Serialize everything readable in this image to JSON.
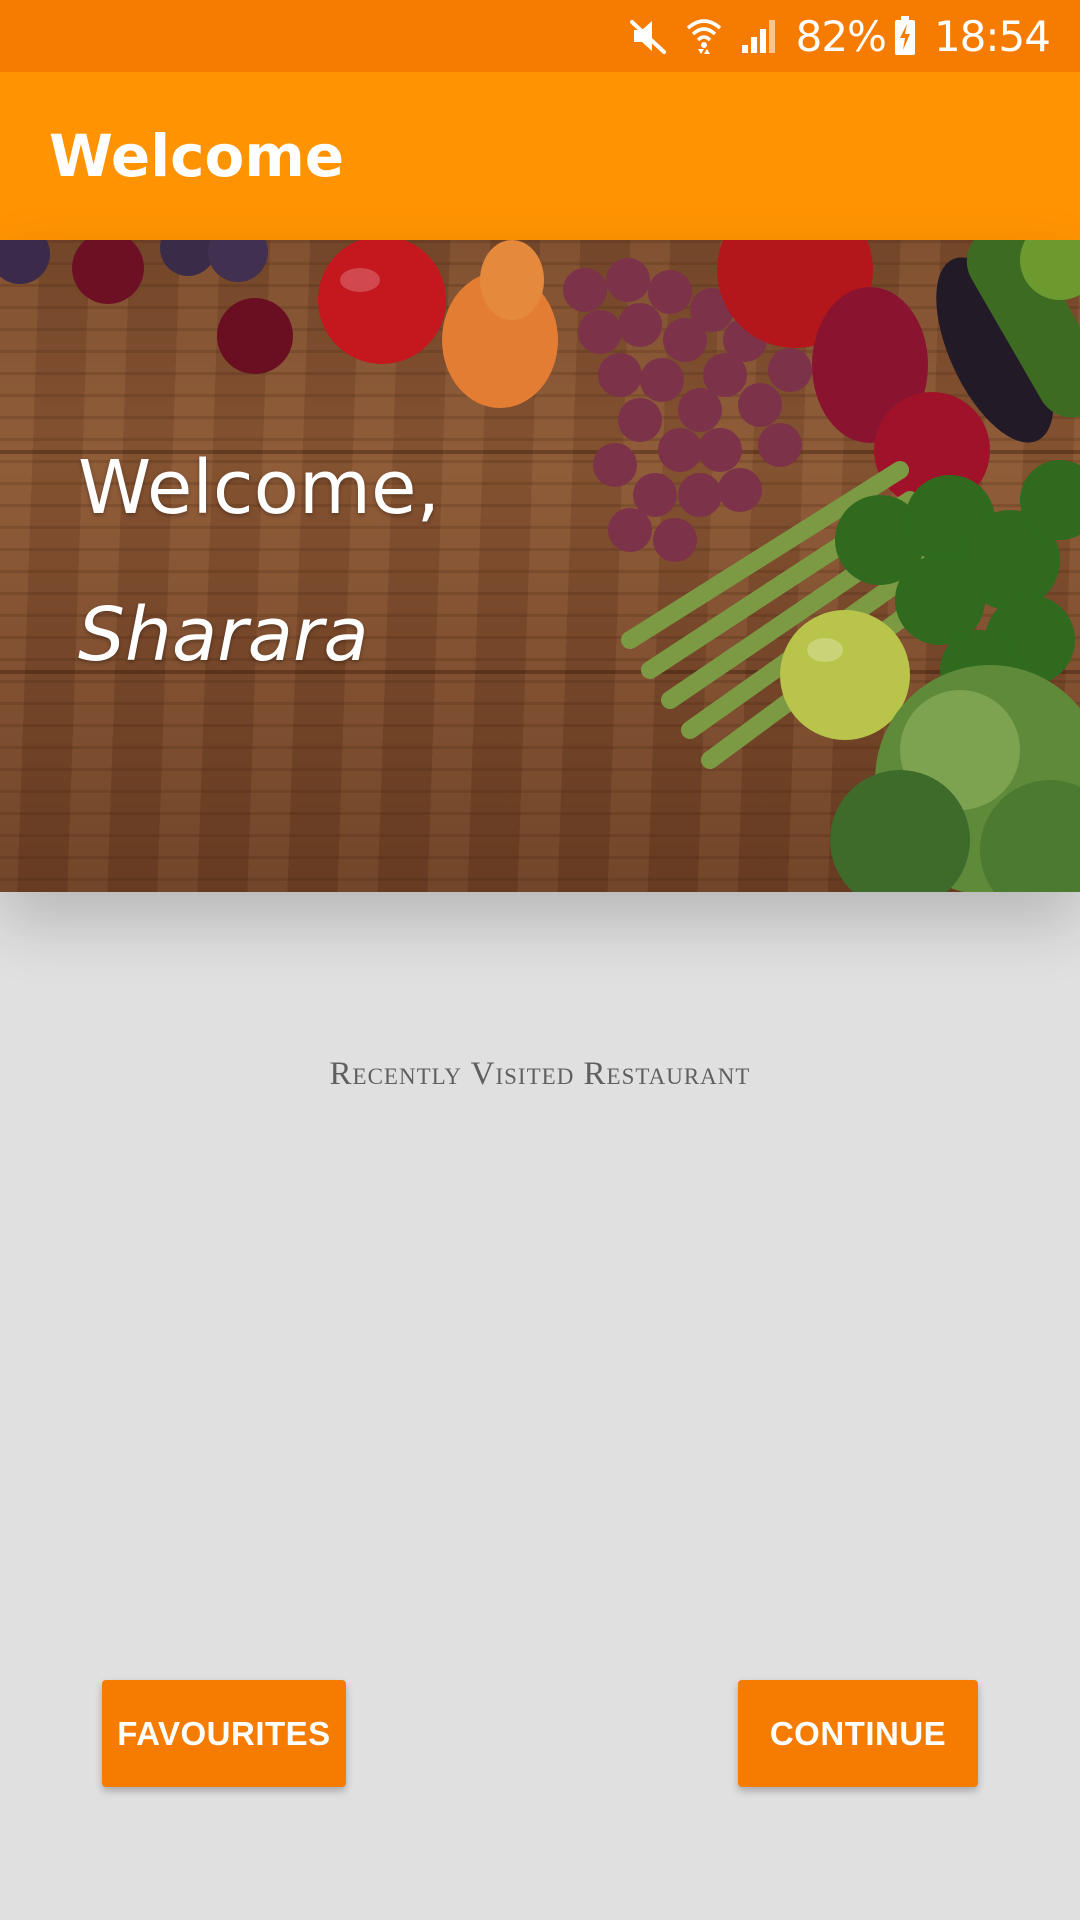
{
  "status_bar": {
    "battery": "82%",
    "time": "18:54",
    "icons": [
      "mute-icon",
      "wifi-icon",
      "signal-icon",
      "battery-charging-icon"
    ]
  },
  "app_bar": {
    "title": "Welcome"
  },
  "hero": {
    "greeting": "Welcome,",
    "username": "Sharara"
  },
  "recent": {
    "label": "Recently Visited Restaurant"
  },
  "actions": {
    "favourites_label": "FAVOURITES",
    "continue_label": "CONTINUE"
  },
  "colors": {
    "status_bar": "#f57c00",
    "app_bar": "#ff9302",
    "button": "#f57c00",
    "background": "#e0e0e0",
    "label_text": "#5f5f5f"
  }
}
